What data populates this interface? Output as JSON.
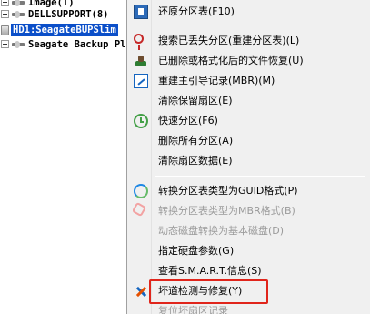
{
  "tree": {
    "items": [
      {
        "label": "Image(T)",
        "selected": false
      },
      {
        "label": "DELLSUPPORT(8)",
        "selected": false
      },
      {
        "label": "HD1:SeagateBUPSlim",
        "selected": true
      },
      {
        "label": "Seagate Backup Pl",
        "selected": false
      }
    ]
  },
  "menu": {
    "items": [
      {
        "label": "还原分区表(F10)",
        "icon": "restore-icon",
        "disabled": false
      },
      {
        "label": "搜索已丢失分区(重建分区表)(L)",
        "icon": "search-icon",
        "disabled": false
      },
      {
        "label": "已删除或格式化后的文件恢复(U)",
        "icon": "file-recover-icon",
        "disabled": false
      },
      {
        "label": "重建主引导记录(MBR)(M)",
        "icon": "rebuild-mbr-icon",
        "disabled": false
      },
      {
        "label": "清除保留扇区(E)",
        "icon": "",
        "disabled": false
      },
      {
        "label": "快速分区(F6)",
        "icon": "clock-icon",
        "disabled": false
      },
      {
        "label": "删除所有分区(A)",
        "icon": "",
        "disabled": false
      },
      {
        "label": "清除扇区数据(E)",
        "icon": "",
        "disabled": false
      },
      {
        "label": "转换分区表类型为GUID格式(P)",
        "icon": "convert-guid-icon",
        "disabled": false
      },
      {
        "label": "转换分区表类型为MBR格式(B)",
        "icon": "convert-mbr-icon",
        "disabled": true
      },
      {
        "label": "动态磁盘转换为基本磁盘(D)",
        "icon": "",
        "disabled": true
      },
      {
        "label": "指定硬盘参数(G)",
        "icon": "",
        "disabled": false
      },
      {
        "label": "查看S.M.A.R.T.信息(S)",
        "icon": "",
        "disabled": false
      },
      {
        "label": "坏道检测与修复(Y)",
        "icon": "tools-icon",
        "disabled": false
      },
      {
        "label": "复位坏扇区记录",
        "icon": "",
        "disabled": true
      }
    ],
    "highlighted_item": "坏道检测与修复(Y)"
  },
  "colors": {
    "selection": "#0b4fc9",
    "highlight_frame": "#e0251b",
    "menu_background": "#f0f0f0",
    "disabled_text": "#9b9b9b"
  }
}
